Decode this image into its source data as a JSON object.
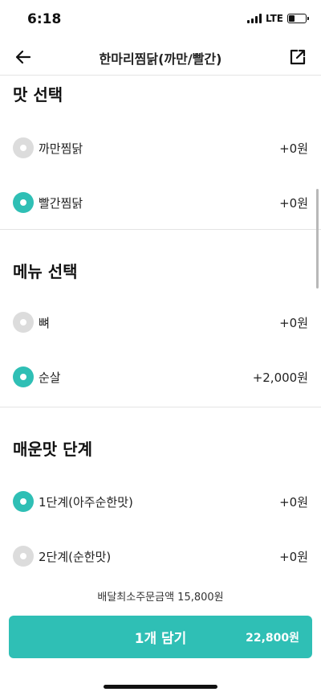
{
  "status": {
    "time": "6:18",
    "network": "LTE",
    "battery_level": 0.35
  },
  "nav": {
    "title": "한마리찜닭(까만/빨간)",
    "back_icon": "arrow-left-icon",
    "share_icon": "share-icon"
  },
  "sections": [
    {
      "title": "맛 선택",
      "options": [
        {
          "label": "까만찜닭",
          "price": "+0원",
          "selected": false
        },
        {
          "label": "빨간찜닭",
          "price": "+0원",
          "selected": true
        }
      ]
    },
    {
      "title": "메뉴 선택",
      "options": [
        {
          "label": "뼈",
          "price": "+0원",
          "selected": false
        },
        {
          "label": "순살",
          "price": "+2,000원",
          "selected": true
        }
      ]
    },
    {
      "title": "매운맛 단계",
      "options": [
        {
          "label": "1단계(아주순한맛)",
          "price": "+0원",
          "selected": true
        },
        {
          "label": "2단계(순한맛)",
          "price": "+0원",
          "selected": false
        }
      ]
    }
  ],
  "footer": {
    "min_order_text": "배달최소주문금액 15,800원",
    "cart_button_label": "1개 담기",
    "cart_total": "22,800원"
  },
  "colors": {
    "accent": "#2fbfb5",
    "radio_off": "#dcdcdc",
    "divider": "#e4e4e4"
  }
}
